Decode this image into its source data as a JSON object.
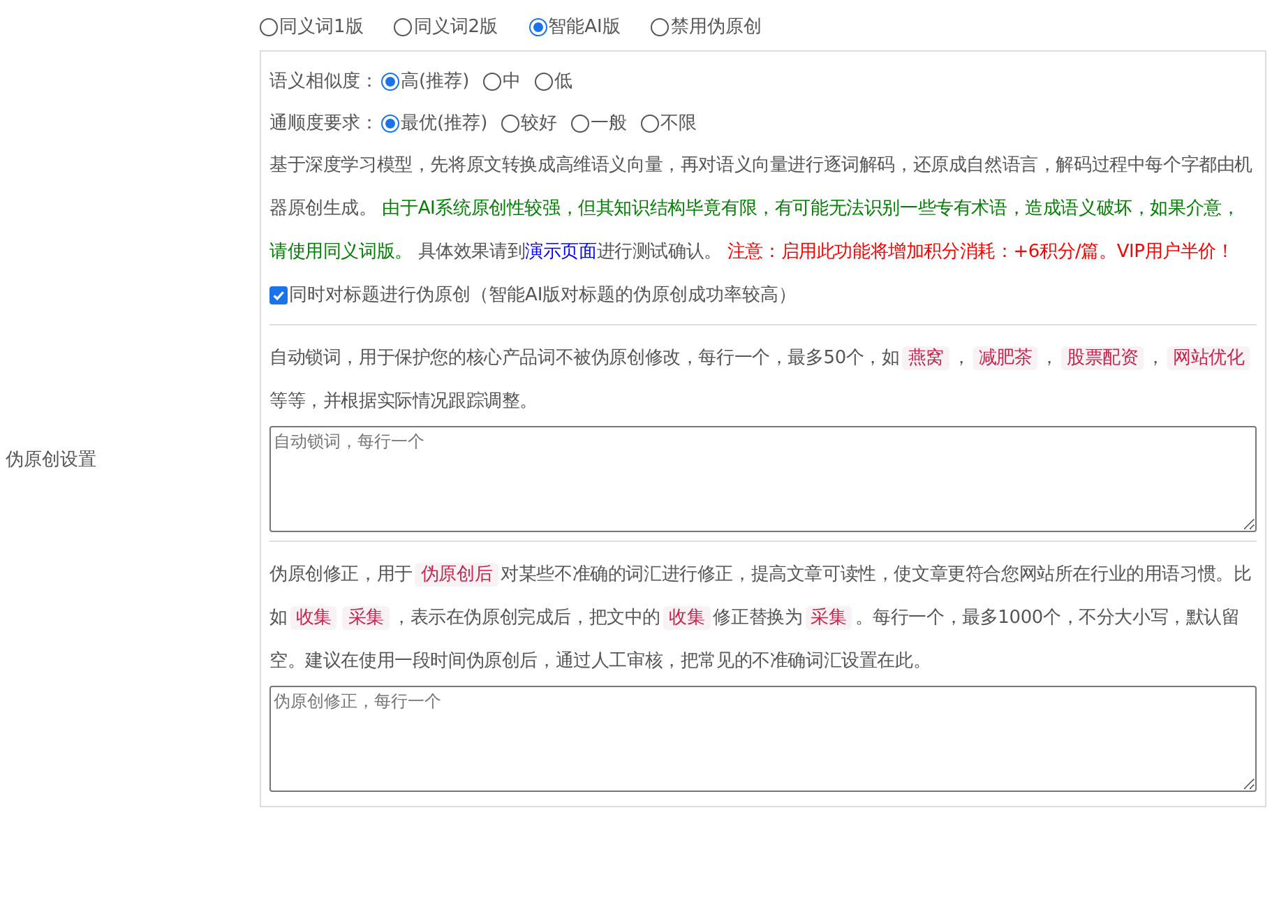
{
  "sidebar_label": "伪原创设置",
  "mode_options": [
    {
      "label": "同义词1版",
      "selected": false
    },
    {
      "label": "同义词2版",
      "selected": false
    },
    {
      "label": "智能AI版",
      "selected": true
    },
    {
      "label": "禁用伪原创",
      "selected": false
    }
  ],
  "settings": [
    {
      "label": "语义相似度：",
      "options": [
        {
          "label": "高(推荐)",
          "selected": true
        },
        {
          "label": "中",
          "selected": false
        },
        {
          "label": "低",
          "selected": false
        }
      ]
    },
    {
      "label": "通顺度要求：",
      "options": [
        {
          "label": "最优(推荐)",
          "selected": true
        },
        {
          "label": "较好",
          "selected": false
        },
        {
          "label": "一般",
          "selected": false
        },
        {
          "label": "不限",
          "selected": false
        }
      ]
    }
  ],
  "description": [
    {
      "kind": "plain",
      "text": "基于深度学习模型，先将原文转换成高维语义向量，再对语义向量进行逐词解码，还原成自然语言，解码过程中每个字都由机器原创生成。 "
    },
    {
      "kind": "green",
      "text": "由于AI系统原创性较强，但其知识结构毕竟有限，有可能无法识别一些专有术语，造成语义破坏，如果介意，请使用同义词版。"
    },
    {
      "kind": "plain",
      "text": " 具体效果请到"
    },
    {
      "kind": "link",
      "text": "演示页面"
    },
    {
      "kind": "plain",
      "text": "进行测试确认。 "
    },
    {
      "kind": "red",
      "text": "注意：启用此功能将增加积分消耗：+6积分/篇。VIP用户半价！"
    }
  ],
  "title_option": {
    "label": "同时对标题进行伪原创（智能AI版对标题的伪原创成功率较高）",
    "checked": true
  },
  "lock_words": {
    "segments": [
      {
        "kind": "text",
        "text": "自动锁词，用于保护您的核心产品词不被伪原创修改，每行一个，最多50个，如"
      },
      {
        "kind": "tag",
        "text": "燕窝"
      },
      {
        "kind": "text",
        "text": "，"
      },
      {
        "kind": "tag",
        "text": "减肥茶"
      },
      {
        "kind": "text",
        "text": "，"
      },
      {
        "kind": "tag",
        "text": "股票配资"
      },
      {
        "kind": "text",
        "text": "，"
      },
      {
        "kind": "tag",
        "text": "网站优化"
      },
      {
        "kind": "text",
        "text": " 等等，并根据实际情况跟踪调整。"
      }
    ],
    "placeholder": "自动锁词，每行一个"
  },
  "corrections": {
    "segments": [
      {
        "kind": "text",
        "text": "伪原创修正，用于"
      },
      {
        "kind": "tag",
        "text": "伪原创后"
      },
      {
        "kind": "text",
        "text": "对某些不准确的词汇进行修正，提高文章可读性，使文章更符合您网站所在行业的用语习惯。比如"
      },
      {
        "kind": "tag",
        "text": "收集"
      },
      {
        "kind": "tag",
        "text": "采集"
      },
      {
        "kind": "text",
        "text": "，表示在伪原创完成后，把文中的"
      },
      {
        "kind": "tag",
        "text": "收集"
      },
      {
        "kind": "text",
        "text": "修正替换为"
      },
      {
        "kind": "tag",
        "text": "采集"
      },
      {
        "kind": "text",
        "text": "。每行一个，最多1000个，不分大小写，默认留空。建议在使用一段时间伪原创后，通过人工审核，把常见的不准确词汇设置在此。"
      }
    ],
    "placeholder": "伪原创修正，每行一个"
  }
}
